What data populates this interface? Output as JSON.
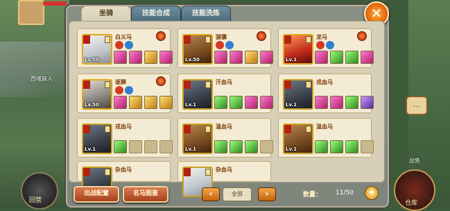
{
  "map": {
    "label_west_merchant": "西域商人",
    "label_back": "回营",
    "label_warehouse": "仓库",
    "label_exit": "出售"
  },
  "tabs": [
    "坐骑",
    "技能合成",
    "技能洗炼"
  ],
  "close_icon": "close-icon",
  "colors": {
    "accent": "#e46a0e",
    "panel": "#7f857b",
    "card_bg": "#f3ebd3"
  },
  "cards": [
    {
      "name": "白义马",
      "level": "Lv.50",
      "portrait": "white-horse",
      "frame": "gold",
      "tags": [
        "red",
        "blue"
      ],
      "skills": [
        "pink",
        "pink",
        "gold",
        "pink"
      ]
    },
    {
      "name": "骐骥",
      "level": "Lv.50",
      "portrait": "brown-horse",
      "frame": "gold",
      "tags": [
        "red",
        "blue"
      ],
      "skills": [
        "pink",
        "pink",
        "gold",
        "pink"
      ]
    },
    {
      "name": "龙马",
      "level": "Lv.1",
      "portrait": "red-horse",
      "frame": "gold",
      "tags": [
        "red",
        "blue"
      ],
      "skills": [
        "pink",
        "green",
        "green",
        "pink"
      ]
    },
    {
      "name": "逐狮",
      "level": "Lv.50",
      "portrait": "grey-horse",
      "frame": "gold",
      "tags": [
        "red",
        "blue"
      ],
      "skills": [
        "pink",
        "gold",
        "gold",
        "gold"
      ]
    },
    {
      "name": "汗血马",
      "level": "Lv.1",
      "portrait": "dark-horse",
      "frame": "purple",
      "tags": [],
      "skills": [
        "green",
        "green",
        "pink",
        "pink"
      ]
    },
    {
      "name": "戎血马",
      "level": "Lv.1",
      "portrait": "dark-horse",
      "frame": "purple",
      "tags": [],
      "skills": [
        "pink",
        "pink",
        "green",
        "purple"
      ]
    },
    {
      "name": "戎血马",
      "level": "Lv.1",
      "portrait": "dark-horse",
      "frame": "purple",
      "tags": [],
      "skills": [
        "green",
        "empty",
        "empty",
        "empty"
      ]
    },
    {
      "name": "温血马",
      "level": "Lv.1",
      "portrait": "brown-horse",
      "frame": "purple",
      "tags": [],
      "skills": [
        "green",
        "green",
        "green",
        "empty"
      ]
    },
    {
      "name": "温血马",
      "level": "Lv.1",
      "portrait": "brown-horse",
      "frame": "purple",
      "tags": [],
      "skills": [
        "green",
        "green",
        "green",
        "empty"
      ]
    },
    {
      "name": "杂血马",
      "level": "",
      "portrait": "dark-horse",
      "frame": "purple",
      "tags": [],
      "skills": []
    },
    {
      "name": "杂血马",
      "level": "",
      "portrait": "white-horse",
      "frame": "purple",
      "tags": [],
      "skills": []
    }
  ],
  "bottom": {
    "battle_config": "出战配置",
    "horse_gallery": "名马图鉴",
    "page_select": "全部",
    "count_label": "数量：",
    "count_value": "11/50"
  }
}
